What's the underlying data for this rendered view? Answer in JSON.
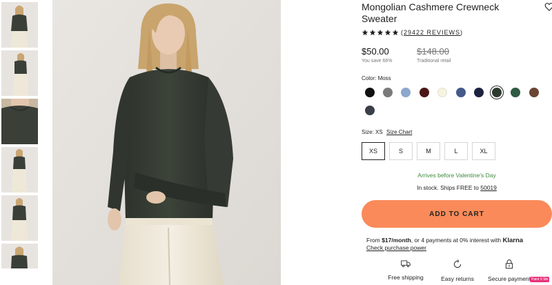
{
  "product": {
    "title": "Mongolian Cashmere Crewneck Sweater",
    "rating": 5,
    "reviews_label": "29422 REVIEWS",
    "price": "$50.00",
    "you_save": "You save 66%",
    "original_price": "$148.00",
    "original_note": "Traditional retail"
  },
  "color": {
    "label": "Color: Moss",
    "swatches": [
      {
        "name": "black",
        "hex": "#111111"
      },
      {
        "name": "grey",
        "hex": "#7a7a7a"
      },
      {
        "name": "light-blue",
        "hex": "#8ea7cc"
      },
      {
        "name": "burgundy",
        "hex": "#4a1716"
      },
      {
        "name": "ivory",
        "hex": "#f7f3e1"
      },
      {
        "name": "denim-blue",
        "hex": "#455a8c"
      },
      {
        "name": "navy",
        "hex": "#1d2240"
      },
      {
        "name": "moss",
        "hex": "#2f3a2f",
        "selected": true
      },
      {
        "name": "green",
        "hex": "#2f5a44"
      },
      {
        "name": "brown",
        "hex": "#6a4532"
      },
      {
        "name": "charcoal",
        "hex": "#3b3f4a"
      }
    ]
  },
  "size": {
    "label": "Size: XS",
    "chart_link": "Size Chart",
    "options": [
      "XS",
      "S",
      "M",
      "L",
      "XL"
    ],
    "selected": "XS"
  },
  "shipping": {
    "arrival": "Arrives before Valentine's Day",
    "stock_prefix": "In stock. Ships FREE to ",
    "zip": "50019"
  },
  "cart": {
    "button_label": "ADD TO CART"
  },
  "klarna": {
    "prefix": "From ",
    "amount": "$17/month",
    "middle": ", or 4 payments at 0% interest with ",
    "brand": "Klarna",
    "link": "Check purchase power"
  },
  "features": [
    {
      "icon": "truck-icon",
      "label": "Free shipping"
    },
    {
      "icon": "return-icon",
      "label": "Easy returns"
    },
    {
      "icon": "lock-icon",
      "label": "Secure payment"
    }
  ],
  "badge": "Paint X Me",
  "colors": {
    "accent": "#fa8a59",
    "arrival_text": "#3f8a3c",
    "sweater": "#3a4038"
  }
}
